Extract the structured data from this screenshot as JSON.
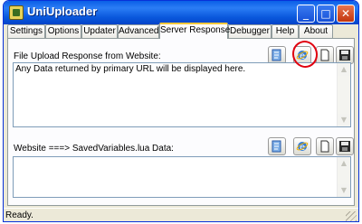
{
  "window": {
    "title": "UniUploader",
    "controls": {
      "minimize": "_",
      "maximize": "□",
      "close": "✕"
    }
  },
  "tabs": [
    {
      "label": "Settings",
      "active": false
    },
    {
      "label": "Options",
      "active": false
    },
    {
      "label": "Updater",
      "active": false
    },
    {
      "label": "Advanced",
      "active": false
    },
    {
      "label": "Server Response",
      "active": true
    },
    {
      "label": "Debugger",
      "active": false
    },
    {
      "label": "Help",
      "active": false
    },
    {
      "label": "About",
      "active": false
    }
  ],
  "server_response": {
    "upload_section": {
      "label": "File Upload Response from Website:",
      "content": "Any Data returned by primary URL will be displayed here.",
      "toolbar": [
        "notepad-icon",
        "browser-icon",
        "new-page-icon",
        "save-icon"
      ],
      "highlighted_button": "browser-icon"
    },
    "saved_vars_section": {
      "label": "Website ===> SavedVariables.lua Data:",
      "content": "",
      "toolbar": [
        "notepad-icon",
        "browser-icon",
        "new-page-icon",
        "save-icon"
      ]
    }
  },
  "status": {
    "text": "Ready."
  },
  "colors": {
    "titlebar": "#0a5fe6",
    "window_bg": "#ece9d8",
    "active_tab_accent": "#ffc83c",
    "highlight_circle": "#e0000f"
  }
}
